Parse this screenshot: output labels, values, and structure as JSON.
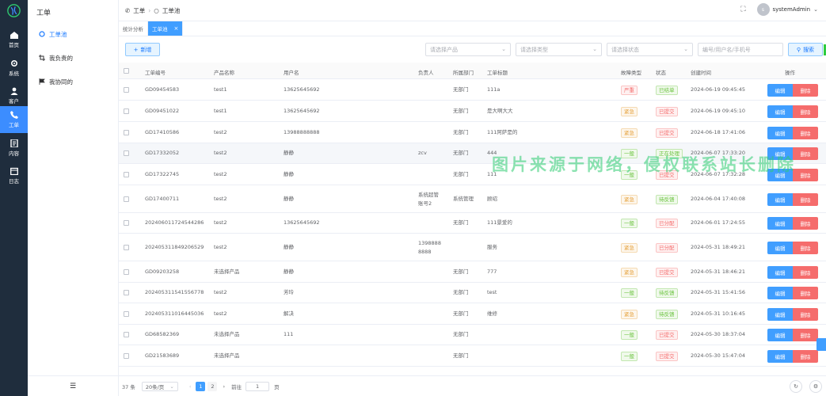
{
  "rail": [
    {
      "label": "首页",
      "icon": "home-icon"
    },
    {
      "label": "系统",
      "icon": "gear-icon"
    },
    {
      "label": "客户",
      "icon": "user-icon"
    },
    {
      "label": "工单",
      "icon": "phone-icon",
      "active": true
    },
    {
      "label": "内容",
      "icon": "document-icon"
    },
    {
      "label": "日志",
      "icon": "calendar-icon"
    }
  ],
  "side": {
    "title": "工单",
    "items": [
      {
        "label": "工单池",
        "icon": "circle-icon",
        "active": true
      },
      {
        "label": "我负责的",
        "icon": "crop-icon"
      },
      {
        "label": "我协同的",
        "icon": "flag-icon"
      }
    ]
  },
  "header": {
    "crumb_parent": "工单",
    "crumb_current": "工单池",
    "user": "systemAdmin",
    "avatar_initial": "s"
  },
  "tabs": [
    {
      "label": "统计分析"
    },
    {
      "label": "工单池",
      "active": true,
      "close": "×"
    }
  ],
  "toolbar": {
    "add": "新增",
    "product_ph": "请选择产品",
    "type_ph": "请选择类型",
    "status_ph": "请选择状态",
    "keyword_ph": "编号/用户名/手机号",
    "search": "搜索"
  },
  "columns": [
    "工单编号",
    "产品名称",
    "用户名",
    "负责人",
    "所属部门",
    "工单标题",
    "故障类型",
    "状态",
    "创建时间",
    "操作"
  ],
  "rows": [
    {
      "id": "GD09454583",
      "product": "test1",
      "user": "13625645692",
      "owner": "",
      "dept": "无部门",
      "title": "111a",
      "fault": "严重",
      "fault_cls": "t-yan",
      "status": "已结单",
      "status_cls": "t-ok",
      "time": "2024-06-19 09:45:45"
    },
    {
      "id": "GD09451022",
      "product": "test1",
      "user": "13625645692",
      "owner": "",
      "dept": "无部门",
      "title": "是大啊大大",
      "fault": "紧急",
      "fault_cls": "t-jin",
      "status": "已提交",
      "status_cls": "t-sub",
      "time": "2024-06-19 09:45:10"
    },
    {
      "id": "GD17410586",
      "product": "test2",
      "user": "13988888888",
      "owner": "",
      "dept": "无部门",
      "title": "111阿萨是的",
      "fault": "紧急",
      "fault_cls": "t-jin",
      "status": "已提交",
      "status_cls": "t-sub",
      "time": "2024-06-18 17:41:06"
    },
    {
      "id": "GD17332052",
      "product": "test2",
      "user": "静静",
      "owner": "zcv",
      "dept": "无部门",
      "title": "444",
      "fault": "一般",
      "fault_cls": "t-yb",
      "status": "正在处理",
      "status_cls": "t-doing",
      "time": "2024-06-07 17:33:20"
    },
    {
      "id": "GD17322745",
      "product": "test2",
      "user": "静静",
      "owner": "",
      "dept": "无部门",
      "title": "111",
      "fault": "一般",
      "fault_cls": "t-yb",
      "status": "已提交",
      "status_cls": "t-sub",
      "time": "2024-06-07 17:32:28"
    },
    {
      "id": "GD17400711",
      "product": "test2",
      "user": "静静",
      "owner": "系统超管账号2",
      "dept": "系统管理",
      "title": "顾绍",
      "fault": "紧急",
      "fault_cls": "t-jin",
      "status": "待反馈",
      "status_cls": "t-wait",
      "time": "2024-06-04 17:40:08"
    },
    {
      "id": "202406011724544286",
      "product": "test2",
      "user": "13625645692",
      "owner": "",
      "dept": "无部门",
      "title": "111景爱的",
      "fault": "一般",
      "fault_cls": "t-yb",
      "status": "已分配",
      "status_cls": "t-asg",
      "time": "2024-06-01 17:24:55"
    },
    {
      "id": "202405311849206529",
      "product": "test2",
      "user": "静静",
      "owner": "13988888888",
      "dept": "",
      "title": "服务",
      "fault": "紧急",
      "fault_cls": "t-jin",
      "status": "已分配",
      "status_cls": "t-asg",
      "time": "2024-05-31 18:49:21"
    },
    {
      "id": "GD09203258",
      "product": "未选择产品",
      "user": "静静",
      "owner": "",
      "dept": "无部门",
      "title": "777",
      "fault": "紧急",
      "fault_cls": "t-jin",
      "status": "已提交",
      "status_cls": "t-sub",
      "time": "2024-05-31 18:46:21"
    },
    {
      "id": "202405311541556778",
      "product": "test2",
      "user": "芳玲",
      "owner": "",
      "dept": "无部门",
      "title": "test",
      "fault": "一般",
      "fault_cls": "t-yb",
      "status": "待反馈",
      "status_cls": "t-wait",
      "time": "2024-05-31 15:41:56"
    },
    {
      "id": "202405311016445036",
      "product": "test2",
      "user": "解决",
      "owner": "",
      "dept": "无部门",
      "title": "维修",
      "fault": "紧急",
      "fault_cls": "t-jin",
      "status": "待反馈",
      "status_cls": "t-wait",
      "time": "2024-05-31 10:16:45"
    },
    {
      "id": "GD68582369",
      "product": "未选择产品",
      "user": "111",
      "owner": "",
      "dept": "无部门",
      "title": "",
      "fault": "一般",
      "fault_cls": "t-yb",
      "status": "已提交",
      "status_cls": "t-sub",
      "time": "2024-05-30 18:37:04"
    },
    {
      "id": "GD21583689",
      "product": "未选择产品",
      "user": "",
      "owner": "",
      "dept": "无部门",
      "title": "",
      "fault": "一般",
      "fault_cls": "t-yb",
      "status": "已提交",
      "status_cls": "t-sub",
      "time": "2024-05-30 15:47:04"
    }
  ],
  "ops": {
    "edit": "编辑",
    "delete": "删除"
  },
  "pager": {
    "total": "37 条",
    "size": "20条/页",
    "goto": "前往",
    "page_input": "1",
    "unit": "页",
    "pages": [
      "1",
      "2"
    ]
  },
  "watermark": "图片来源于网络，侵权联系站长删除"
}
